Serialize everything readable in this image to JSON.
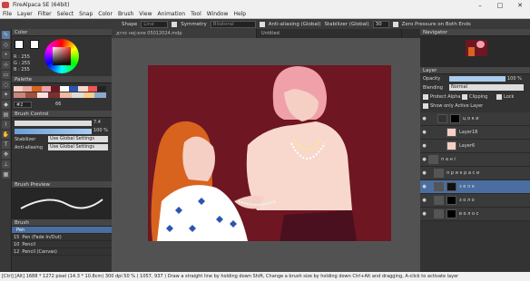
{
  "title": "FireAlpaca SE (64bit)",
  "menu": [
    "File",
    "Layer",
    "Filter",
    "Select",
    "Snap",
    "Color",
    "Brush",
    "View",
    "Animation",
    "Tool",
    "Window",
    "Help"
  ],
  "toolbar": {
    "shape_label": "Shape",
    "shape_value": "Line",
    "symmetry_label": "Symmetry",
    "symmetry_value": "Bilateral",
    "aa_label": "Anti-aliasing (Global)",
    "stabilizer_label": "Stabilizer (Global)",
    "stabilizer_value": "30",
    "pressure_label": "Zero Pressure on Both Ends"
  },
  "tabs": [
    "дтлс неј:еле 05012024.mdp",
    "Untitled"
  ],
  "color": {
    "header": "Color",
    "r": "R : 255",
    "g": "G : 255",
    "b": "B : 255"
  },
  "palette": {
    "header": "Palette",
    "num": "#2",
    "count": "66"
  },
  "brush_control": {
    "header": "Brush Control",
    "size": "7.4",
    "opacity": "100 %",
    "stabilizer_label": "Stabilizer",
    "stabilizer_value": "Use Global Settings",
    "aa_label": "Anti-aliasing",
    "aa_value": "Use Global Settings"
  },
  "brush_preview": {
    "header": "Brush Preview"
  },
  "brush": {
    "header": "Brush",
    "items": [
      {
        "size": "",
        "name": "Pen"
      },
      {
        "size": "15",
        "name": "Pen (Fade In/Out)"
      },
      {
        "size": "10",
        "name": "Pencil"
      },
      {
        "size": "12",
        "name": "Pencil (Canvas)"
      }
    ]
  },
  "navigator": {
    "header": "Navigator"
  },
  "layer": {
    "header": "Layer",
    "opacity_label": "Opacity",
    "opacity_value": "100 %",
    "blending_label": "Blending",
    "blending_value": "Normal",
    "protect_alpha": "Protect Alpha",
    "clipping": "Clipping",
    "lock": "Lock",
    "show_only": "Show only Active Layer",
    "rows": [
      {
        "name": "ц о к и",
        "type": "folder"
      },
      {
        "name": "Layer18",
        "type": "layer"
      },
      {
        "name": "Layer6",
        "type": "layer"
      },
      {
        "name": "п а н і",
        "type": "folder"
      },
      {
        "name": "п р и к р а с и",
        "type": "folder"
      },
      {
        "name": "з е л е",
        "type": "folder"
      },
      {
        "name": "з о л о",
        "type": "folder"
      },
      {
        "name": "в о л о с",
        "type": "folder"
      }
    ]
  },
  "status": "[Ctrl] [Alt]   1688 * 1272 pixel  (14.3 * 10.8cm)  300 dpi   50 %   ( 1057, 937 )   Draw a straight line by holding down Shift, Change a brush size by holding down Ctrl+Alt and dragging, A-click to activate layer",
  "colors": {
    "canvas_bg": "#6e1622",
    "hair_orange": "#d8631e",
    "hair_pink": "#f0a0a8",
    "skin": "#f5cfc4",
    "blouse": "#f8d8cc"
  }
}
